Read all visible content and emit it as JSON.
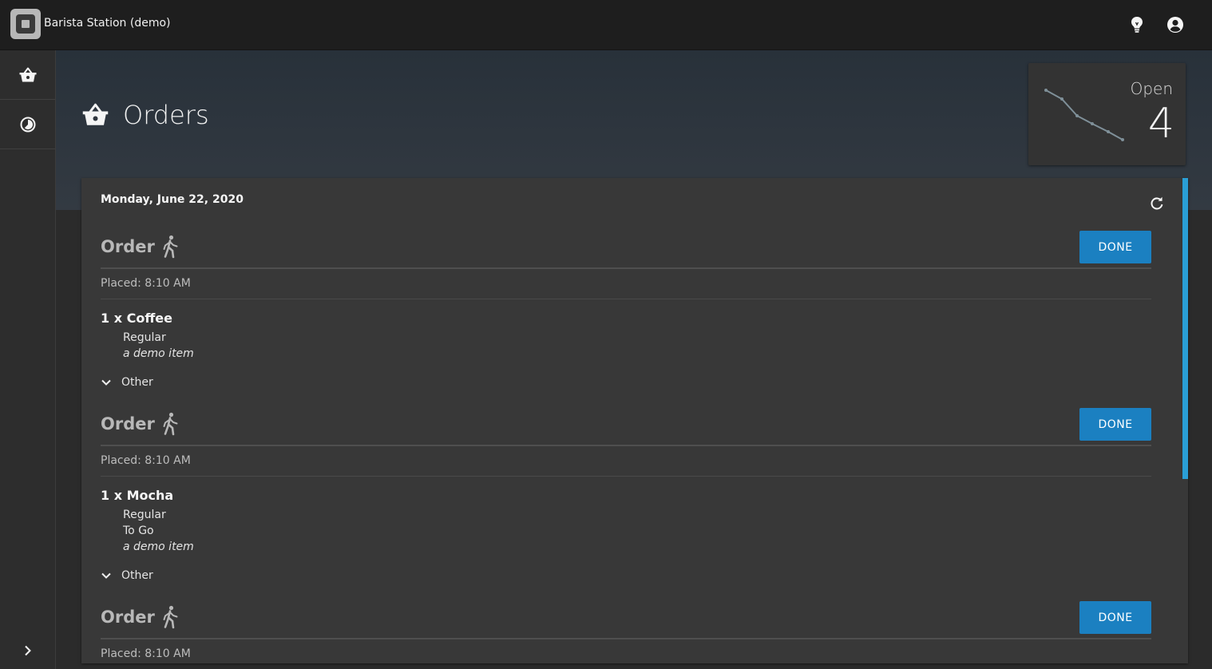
{
  "app": {
    "title": "Barista Station (demo)"
  },
  "page": {
    "title": "Orders"
  },
  "stat": {
    "label": "Open",
    "value": "4"
  },
  "orders_section": {
    "date": "Monday, June 22, 2020",
    "orders": [
      {
        "title": "Order",
        "done_label": "DONE",
        "placed": "Placed: 8:10 AM",
        "item": "1 x Coffee",
        "modifiers": [
          "Regular"
        ],
        "note": "a demo item",
        "other_label": "Other"
      },
      {
        "title": "Order",
        "done_label": "DONE",
        "placed": "Placed: 8:10 AM",
        "item": "1 x Mocha",
        "modifiers": [
          "Regular",
          "To Go"
        ],
        "note": "a demo item",
        "other_label": "Other"
      },
      {
        "title": "Order",
        "done_label": "DONE",
        "placed": "Placed: 8:10 AM"
      }
    ]
  },
  "colors": {
    "accent": "#1b80c1",
    "scroll_accent": "#2a9fd6",
    "background": "#2b2b2b",
    "card": "#383838"
  },
  "icons": [
    "logo-icon",
    "lightbulb-icon",
    "account-circle-icon",
    "basket-icon",
    "timer-icon",
    "chevron-right-icon",
    "refresh-icon",
    "walk-icon",
    "chevron-down-icon"
  ]
}
